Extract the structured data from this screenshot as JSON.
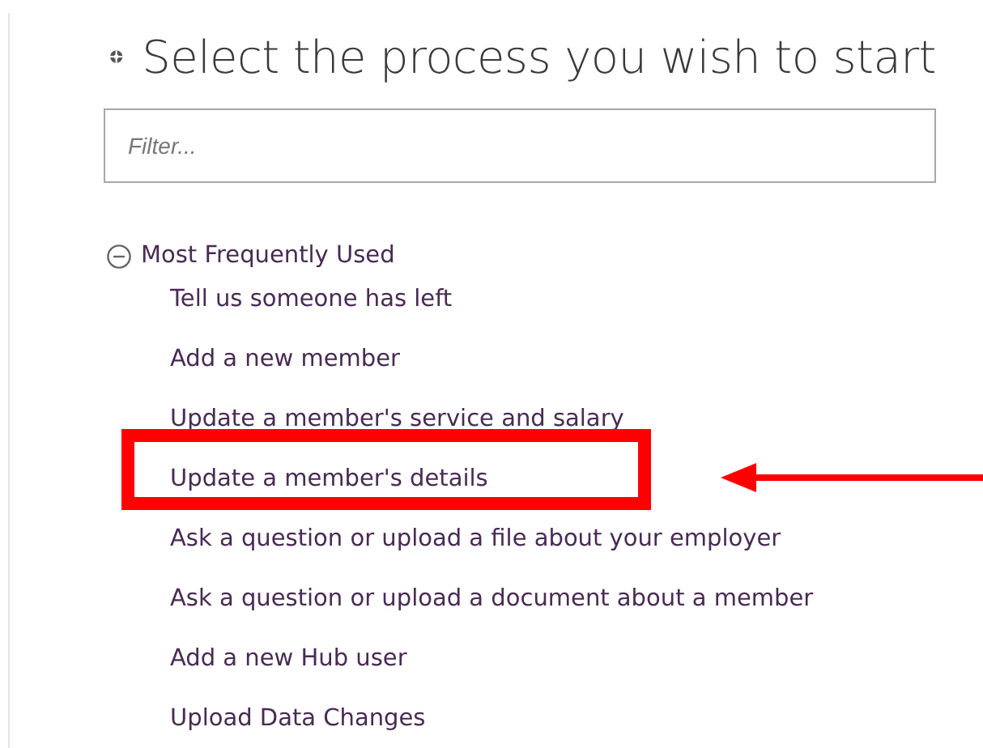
{
  "title": "Select the process you wish to start",
  "filter": {
    "placeholder": "Filter..."
  },
  "group": {
    "label": "Most Frequently Used",
    "expanded": true,
    "items": [
      {
        "label": "Tell us someone has left",
        "highlighted": false
      },
      {
        "label": "Add a new member",
        "highlighted": false
      },
      {
        "label": "Update a member's service and salary",
        "highlighted": false
      },
      {
        "label": "Update a member's details",
        "highlighted": true
      },
      {
        "label": "Ask a question or upload a file about your employer",
        "highlighted": false
      },
      {
        "label": "Ask a question or upload a document about a member",
        "highlighted": false
      },
      {
        "label": "Add a new Hub user",
        "highlighted": false
      },
      {
        "label": "Upload Data Changes",
        "highlighted": false
      }
    ]
  }
}
